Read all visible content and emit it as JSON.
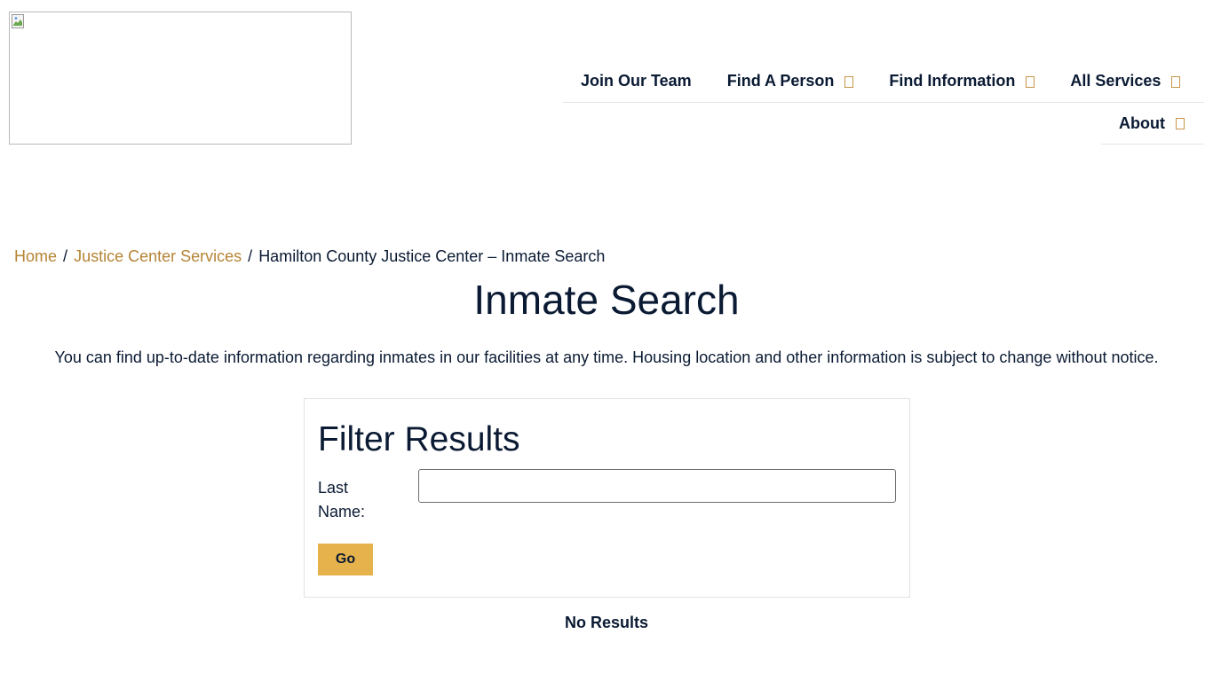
{
  "header": {
    "logo_alt": "",
    "nav": [
      {
        "label": "Join Our Team",
        "has_dropdown": false
      },
      {
        "label": "Find A Person",
        "has_dropdown": true
      },
      {
        "label": "Find Information",
        "has_dropdown": true
      },
      {
        "label": "All Services",
        "has_dropdown": true
      },
      {
        "label": "About",
        "has_dropdown": true
      }
    ]
  },
  "breadcrumb": {
    "home": "Home",
    "sep1": "/",
    "services": "Justice Center Services",
    "sep2": "/",
    "current": "Hamilton County Justice Center – Inmate Search"
  },
  "main": {
    "title": "Inmate Search",
    "intro": "You can find up-to-date information regarding inmates in our facilities at any time. Housing location and other information is subject to change without notice."
  },
  "filter": {
    "title": "Filter Results",
    "last_name_label_line1": "Last",
    "last_name_label_line2": "Name:",
    "last_name_value": "",
    "go_label": "Go"
  },
  "results": {
    "message": "No Results"
  },
  "colors": {
    "text": "#0a1a33",
    "link": "#b58434",
    "button": "#e6b24c",
    "caret": "#c7954a"
  }
}
